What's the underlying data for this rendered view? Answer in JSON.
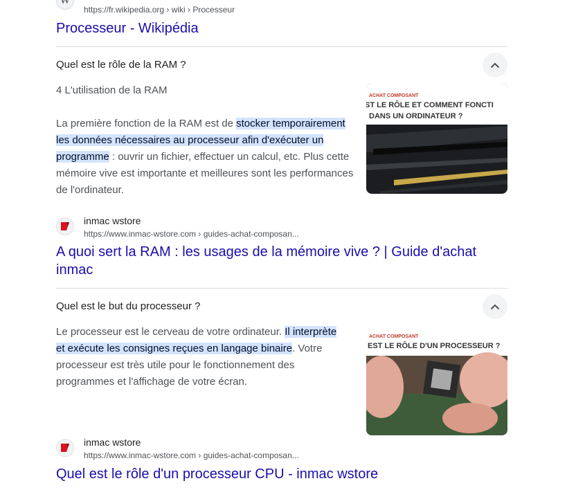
{
  "top_result": {
    "url": "https://fr.wikipedia.org › wiki › Processeur",
    "title": "Processeur - Wikipédia",
    "favicon_letter": "W"
  },
  "faq1": {
    "question": "Quel est le rôle de la RAM ?",
    "heading": "4 L'utilisation de la RAM",
    "text_before": "La première fonction de la RAM est de ",
    "text_highlight": "stocker temporairement les données nécessaires au processeur afin d'exécuter un programme",
    "text_after": " : ouvrir un fichier, effectuer un calcul, etc. Plus cette mémoire vive est importante et meilleures sont les performances de l'ordinateur.",
    "thumb_tag": "ACHAT COMPOSANT",
    "thumb_line1": "ST LE RÔLE ET COMMENT FONCTI",
    "thumb_line2": "DANS UN ORDINATEUR ?",
    "source_name": "inmac wstore",
    "source_url": "https://www.inmac-wstore.com › guides-achat-composan...",
    "result_title": "A quoi sert la RAM : les usages de la mémoire vive ? | Guide d'achat inmac"
  },
  "faq2": {
    "question": "Quel est le but du processeur ?",
    "text_before": "Le processeur est le cerveau de votre ordinateur. ",
    "text_highlight": "Il interprète et exécute les consignes reçues en langage binaire",
    "text_after": ". Votre processeur est très utile pour le fonctionnement des programmes et l'affichage de votre écran.",
    "thumb_tag": "ACHAT COMPOSANT",
    "thumb_line1": "EST LE RÔLE D'UN PROCESSEUR ?",
    "source_name": "inmac wstore",
    "source_url": "https://www.inmac-wstore.com › guides-achat-composan...",
    "result_title": "Quel est le rôle d'un processeur CPU - inmac wstore"
  },
  "colors": {
    "link": "#1a0dab",
    "highlight": "#d3e3fd",
    "divider": "#dadce0",
    "brand_red": "#d9141f"
  }
}
